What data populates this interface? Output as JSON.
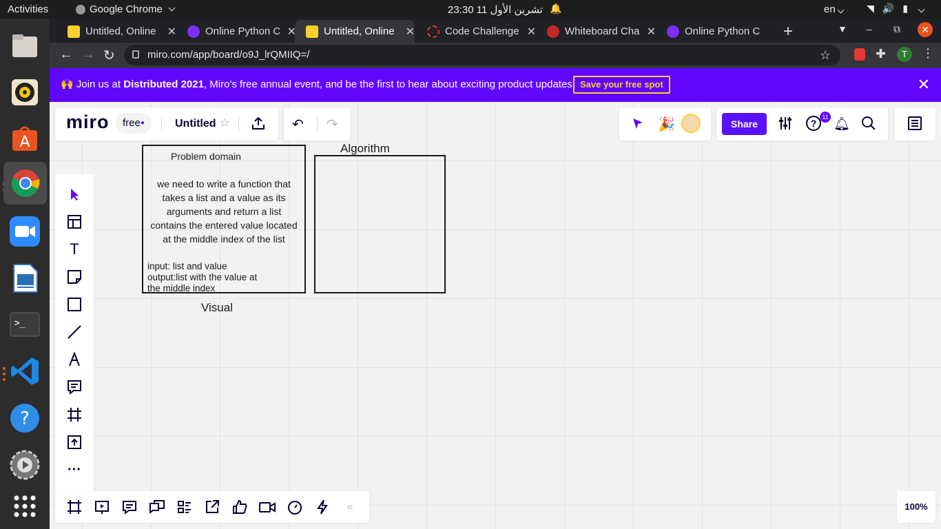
{
  "os": {
    "activities": "Activities",
    "app_menu": "Google Chrome",
    "clock": "تشرين الأول 11  23:30",
    "lang": "en"
  },
  "browser": {
    "tabs": [
      {
        "title": "Untitled, Online",
        "favicon_color": "#ffd02f"
      },
      {
        "title": "Online Python C",
        "favicon_color": "#7b2ff7"
      },
      {
        "title": "Untitled, Online",
        "favicon_color": "#ffd02f"
      },
      {
        "title": "Code Challenge",
        "favicon_color": "#e53935"
      },
      {
        "title": "Whiteboard Cha",
        "favicon_color": "#c62828"
      },
      {
        "title": "Online Python C",
        "favicon_color": "#7b2ff7"
      }
    ],
    "active_tab_index": 2,
    "url": "miro.com/app/board/o9J_lrQMIIQ=/",
    "profile_initial": "T"
  },
  "banner": {
    "prefix": "Join us at ",
    "highlight": "Distributed 2021",
    "suffix": ", Miro's free annual event, and be the first to hear about exciting product updates.",
    "button": "Save your free spot"
  },
  "miro": {
    "logo": "miro",
    "plan": "free",
    "board_title": "Untitled",
    "share_label": "Share",
    "notification_count": "11",
    "zoom": "100%"
  },
  "board": {
    "frame1_title": "Problem domain",
    "frame1_body": "we need to write a function that takes a list and a value as its arguments and return a list contains the entered value located at the middle index of the list",
    "frame1_io": [
      "input: list and value",
      "output:list with the value at",
      "the middle index"
    ],
    "frame2_title": "Algorithm",
    "visual_label": "Visual"
  },
  "colors": {
    "accent": "#6106ff",
    "share_button": "#5a11ff",
    "banner_button": "#ffd02f",
    "ubuntu_orange": "#e95420"
  }
}
